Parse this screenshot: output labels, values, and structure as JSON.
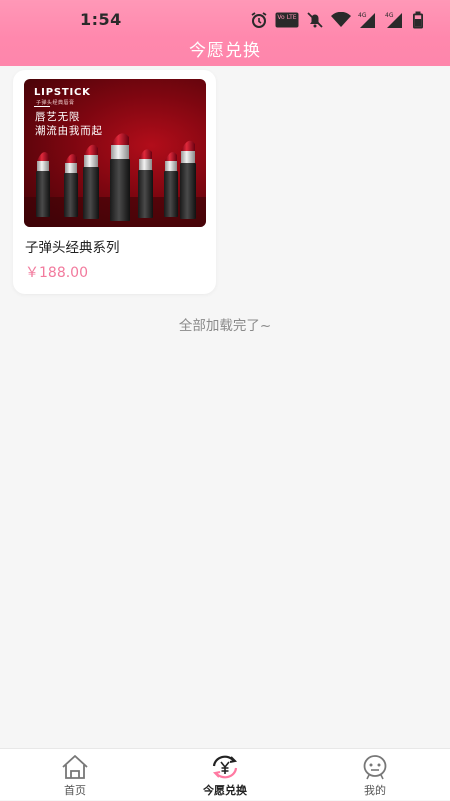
{
  "status_bar": {
    "time": "1:54",
    "icons": [
      "alarm-icon",
      "volte-icon",
      "mute-icon",
      "wifi-icon",
      "signal-4g-icon",
      "signal-4g-icon",
      "battery-icon"
    ],
    "volte_text": "Vo LTE",
    "net_label_1": "4G",
    "net_label_2": "4G"
  },
  "header": {
    "title": "今愿兑换"
  },
  "colors": {
    "accent": "#ff88ad",
    "price": "#f27a9d"
  },
  "products": [
    {
      "name": "子弹头经典系列",
      "price": "￥188.00",
      "image": {
        "brand": "LIPSTICK",
        "subtitle": "子弹头经典唇膏",
        "slogan_line1": "唇艺无限",
        "slogan_line2": "潮流由我而起"
      }
    }
  ],
  "list_footer": "全部加载完了~",
  "tab_bar": {
    "tabs": [
      {
        "label": "首页",
        "icon": "home-icon"
      },
      {
        "label": "今愿兑换",
        "icon": "exchange-yuan-icon",
        "active": true
      },
      {
        "label": "我的",
        "icon": "profile-face-icon"
      }
    ]
  }
}
